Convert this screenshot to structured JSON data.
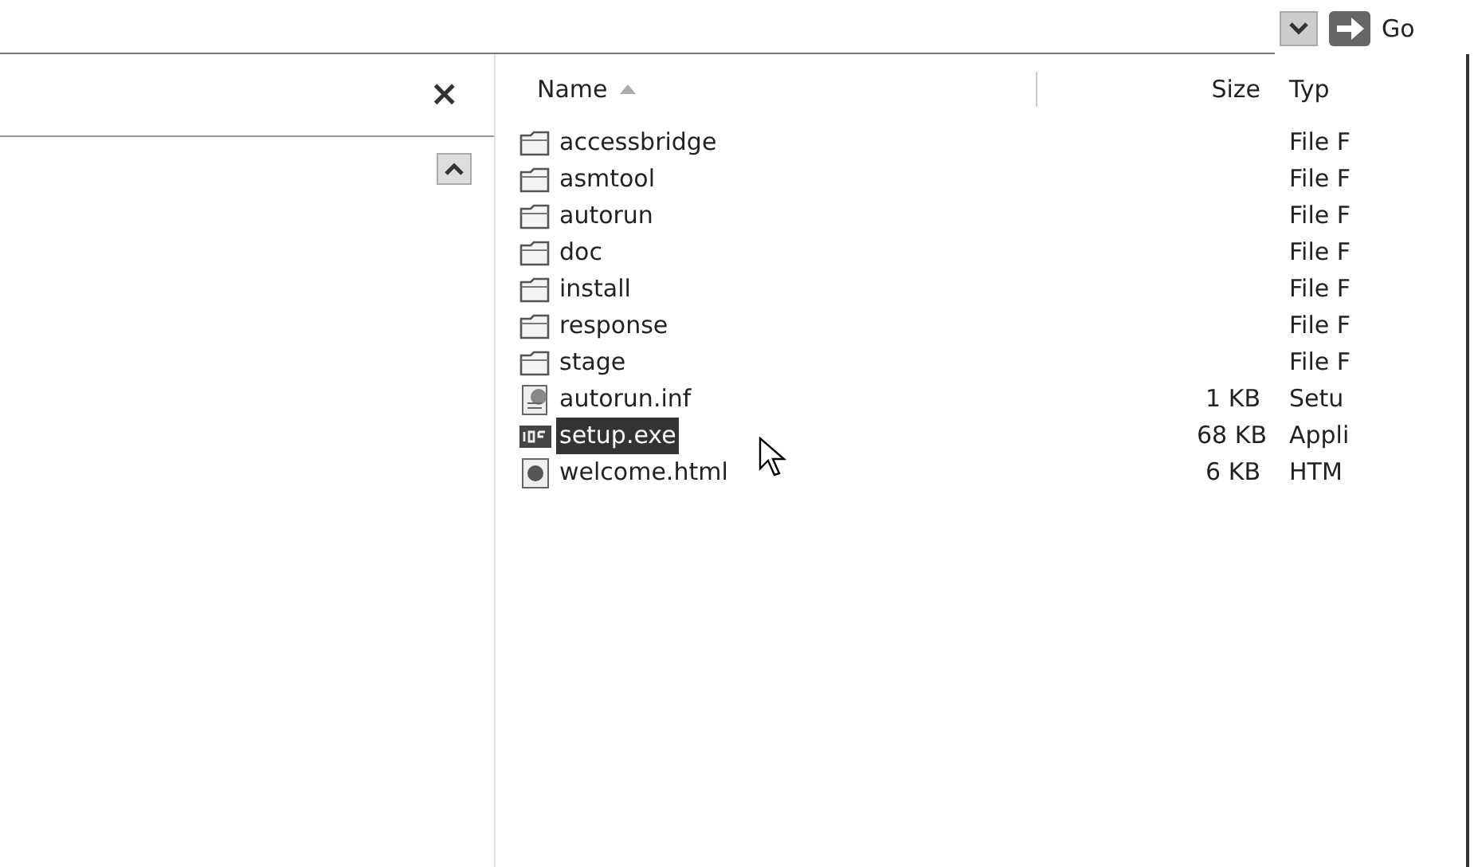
{
  "address_bar": {
    "go_label": "Go"
  },
  "folders_pane": {
    "close": "×"
  },
  "file_list": {
    "columns": [
      {
        "label": "Name",
        "sorted": true
      },
      {
        "label": "Size",
        "sorted": false
      },
      {
        "label": "Typ",
        "sorted": false
      }
    ],
    "rows": [
      {
        "kind": "folder",
        "name": "accessbridge",
        "size": "",
        "type": "File F",
        "selected": false
      },
      {
        "kind": "folder",
        "name": "asmtool",
        "size": "",
        "type": "File F",
        "selected": false
      },
      {
        "kind": "folder",
        "name": "autorun",
        "size": "",
        "type": "File F",
        "selected": false
      },
      {
        "kind": "folder",
        "name": "doc",
        "size": "",
        "type": "File F",
        "selected": false
      },
      {
        "kind": "folder",
        "name": "install",
        "size": "",
        "type": "File F",
        "selected": false
      },
      {
        "kind": "folder",
        "name": "response",
        "size": "",
        "type": "File F",
        "selected": false
      },
      {
        "kind": "folder",
        "name": "stage",
        "size": "",
        "type": "File F",
        "selected": false
      },
      {
        "kind": "inf",
        "name": "autorun.inf",
        "size": "1 KB",
        "type": "Setu",
        "selected": false
      },
      {
        "kind": "exe",
        "name": "setup.exe",
        "size": "68 KB",
        "type": "Appli",
        "selected": true
      },
      {
        "kind": "html",
        "name": "welcome.html",
        "size": "6 KB",
        "type": "HTM",
        "selected": false
      }
    ]
  }
}
